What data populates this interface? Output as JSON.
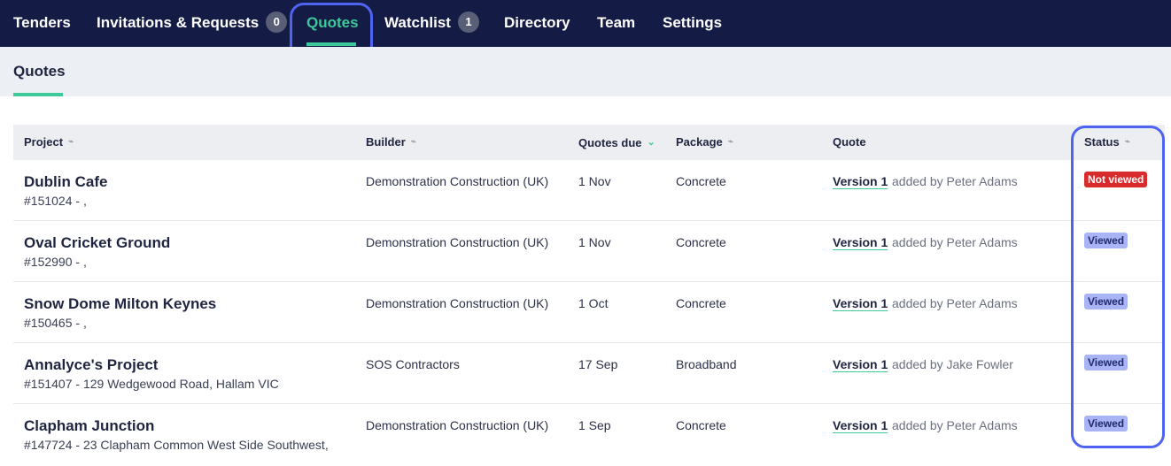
{
  "nav": {
    "items": [
      {
        "label": "Tenders"
      },
      {
        "label": "Invitations & Requests",
        "badge": "0"
      },
      {
        "label": "Quotes"
      },
      {
        "label": "Watchlist",
        "badge": "1"
      },
      {
        "label": "Directory"
      },
      {
        "label": "Team"
      },
      {
        "label": "Settings"
      }
    ],
    "active": "Quotes"
  },
  "subtabs": [
    {
      "label": "Quotes"
    }
  ],
  "table": {
    "headers": [
      "Project",
      "Builder",
      "Quotes due",
      "Package",
      "Quote",
      "Status"
    ],
    "sorted_by": "Quotes due",
    "rows": [
      {
        "name": "Dublin Cafe",
        "sub": "#151024 - ,",
        "builder": "Demonstration Construction (UK)",
        "due": "1 Nov",
        "package": "Concrete",
        "quote": "Version 1",
        "added": "added by Peter Adams",
        "status": "Not viewed"
      },
      {
        "name": "Oval Cricket Ground",
        "sub": "#152990 - ,",
        "builder": "Demonstration Construction (UK)",
        "due": "1 Nov",
        "package": "Concrete",
        "quote": "Version 1",
        "added": "added by Peter Adams",
        "status": "Viewed"
      },
      {
        "name": "Snow Dome Milton Keynes",
        "sub": "#150465 - ,",
        "builder": "Demonstration Construction (UK)",
        "due": "1 Oct",
        "package": "Concrete",
        "quote": "Version 1",
        "added": "added by Peter Adams",
        "status": "Viewed"
      },
      {
        "name": "Annalyce's Project",
        "sub": "#151407 - 129 Wedgewood Road, Hallam VIC",
        "builder": "SOS Contractors",
        "due": "17 Sep",
        "package": "Broadband",
        "quote": "Version 1",
        "added": "added by Jake Fowler",
        "status": "Viewed"
      },
      {
        "name": "Clapham Junction",
        "sub": "#147724 - 23 Clapham Common West Side Southwest,",
        "builder": "Demonstration Construction (UK)",
        "due": "1 Sep",
        "package": "Concrete",
        "quote": "Version 1",
        "added": "added by Peter Adams",
        "status": "Viewed"
      }
    ]
  },
  "colors": {
    "nav_bg": "#141b44",
    "accent": "#3ec99a",
    "highlight": "#4e63f0",
    "not_viewed": "#d82c2c",
    "viewed": "#a9b4f5"
  }
}
